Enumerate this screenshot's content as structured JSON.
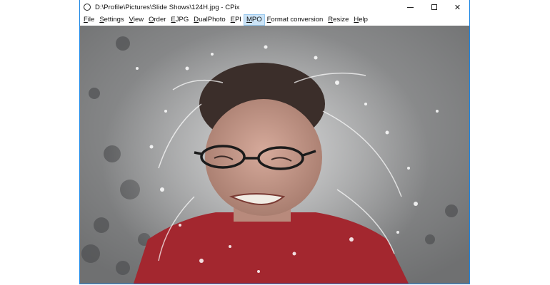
{
  "window": {
    "title": "D:\\Profile\\Pictures\\Slide Shows\\124H.jpg - CPix",
    "app_icon": "circle-icon",
    "controls": {
      "minimize": "minimize-icon",
      "maximize": "maximize-icon",
      "close": "close-icon",
      "close_glyph": "✕"
    }
  },
  "menu": {
    "items": [
      {
        "first": "F",
        "rest": "ile"
      },
      {
        "first": "S",
        "rest": "ettings"
      },
      {
        "first": "V",
        "rest": "iew"
      },
      {
        "first": "O",
        "rest": "rder"
      },
      {
        "first": "E",
        "rest": "JPG"
      },
      {
        "first": "D",
        "rest": "ualPhoto"
      },
      {
        "first": "E",
        "rest": "PI"
      },
      {
        "first": "M",
        "rest": "PO"
      },
      {
        "first": "F",
        "rest": "ormat conversion"
      },
      {
        "first": "R",
        "rest": "esize"
      },
      {
        "first": "H",
        "rest": "elp"
      }
    ],
    "highlighted_index": 7
  },
  "image": {
    "description_icon": "photo-icon",
    "colors": {
      "background": "#8f9091",
      "shirt": "#a3272f",
      "skin": "#c89a8a",
      "hair": "#3b2e2a"
    }
  }
}
